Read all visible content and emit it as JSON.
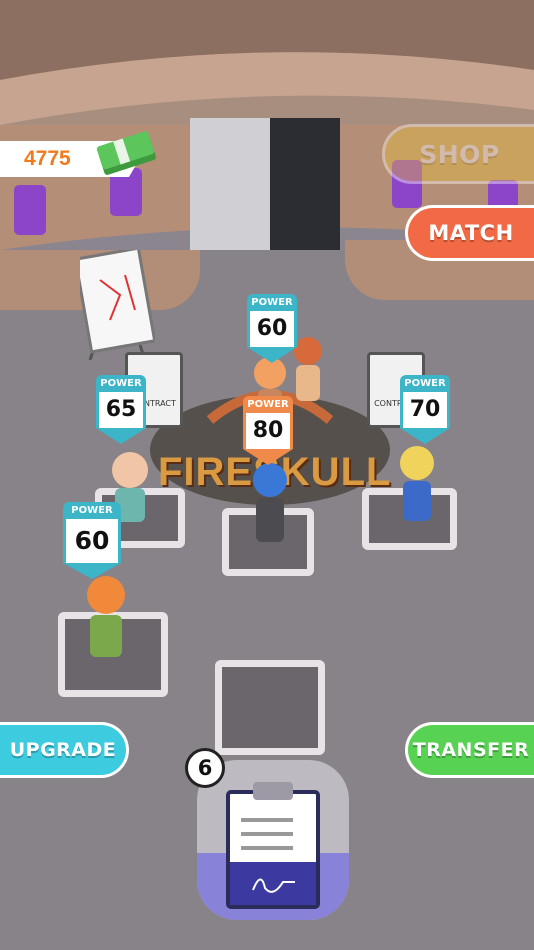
{
  "hud": {
    "money": "4775",
    "money_icon": "cash-stack-icon",
    "shop_label": "SHOP",
    "match_label": "MATCH",
    "upgrade_label": "UPGRADE",
    "transfer_label": "TRANSFER",
    "contract_count": "6"
  },
  "arena": {
    "logo_text": "FIRESKULL"
  },
  "players": [
    {
      "power_label": "POWER",
      "power": "60"
    },
    {
      "power_label": "POWER",
      "power": "65"
    },
    {
      "power_label": "POWER",
      "power": "80"
    },
    {
      "power_label": "POWER",
      "power": "70"
    },
    {
      "power_label": "POWER",
      "power": "60"
    }
  ],
  "contract_papers": [
    {
      "text": "CONTRACT"
    },
    {
      "text": "CONTRACT"
    }
  ],
  "colors": {
    "shop": "#e8c13a",
    "match": "#f26a45",
    "upgrade": "#3dcbe0",
    "transfer": "#57d252",
    "money_text": "#f07a1c",
    "power_cap": "#3bb5c7",
    "power_cap_highlight": "#f08a4b"
  }
}
